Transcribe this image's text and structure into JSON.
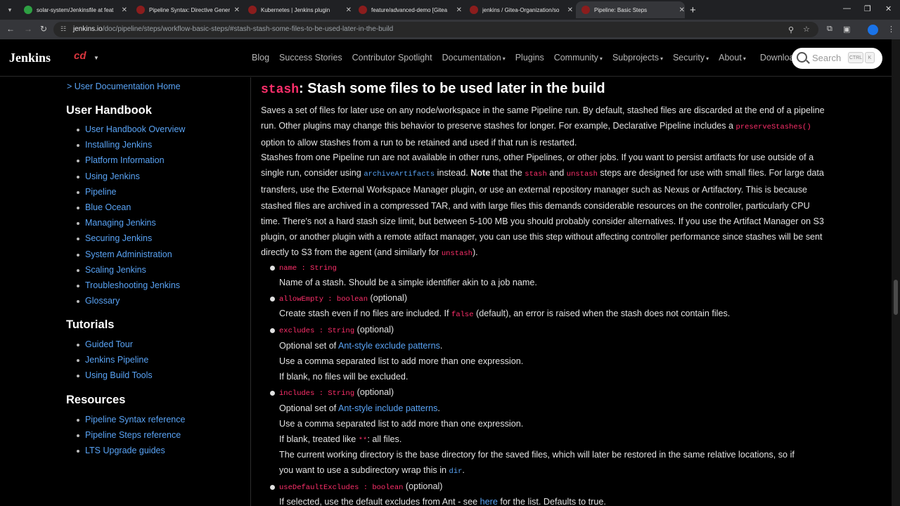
{
  "browser": {
    "tabs": [
      {
        "title": "solar-system/Jenkinsfile at feat",
        "color": "#2ea043"
      },
      {
        "title": "Pipeline Syntax: Directive Gener",
        "color": "#8b1d1d"
      },
      {
        "title": "Kubernetes | Jenkins plugin",
        "color": "#8b1d1d"
      },
      {
        "title": "feature/advanced-demo [Gitea",
        "color": "#8b1d1d"
      },
      {
        "title": "jenkins / Gitea-Organization/so",
        "color": "#8b1d1d"
      },
      {
        "title": "Pipeline: Basic Steps",
        "color": "#8b1d1d"
      }
    ],
    "url_domain": "jenkins.io",
    "url_path": "/doc/pipeline/steps/workflow-basic-steps/#stash-stash-some-files-to-be-used-later-in-the-build"
  },
  "navbar": {
    "brand": "Jenkins",
    "cd_logo": "cd",
    "links": [
      {
        "label": "Blog",
        "caret": ""
      },
      {
        "label": "Success Stories",
        "caret": ""
      },
      {
        "label": "Contributor Spotlight",
        "caret": ""
      },
      {
        "label": "Documentation",
        "caret": "▾"
      },
      {
        "label": "Plugins",
        "caret": ""
      },
      {
        "label": "Community",
        "caret": "▾"
      },
      {
        "label": "Subprojects",
        "caret": "▾"
      },
      {
        "label": "Security",
        "caret": "▾"
      },
      {
        "label": "About",
        "caret": "▾"
      },
      {
        "label": "Download",
        "caret": ""
      }
    ],
    "search_placeholder": "Search",
    "kbd_ctrl": "CTRL",
    "kbd_k": "K"
  },
  "sidebar": {
    "home_link": "> User Documentation Home",
    "sections": [
      {
        "title": "User Handbook",
        "items": [
          "User Handbook Overview",
          "Installing Jenkins",
          "Platform Information",
          "Using Jenkins",
          "Pipeline",
          "Blue Ocean",
          "Managing Jenkins",
          "Securing Jenkins",
          "System Administration",
          "Scaling Jenkins",
          "Troubleshooting Jenkins",
          "Glossary"
        ]
      },
      {
        "title": "Tutorials",
        "items": [
          "Guided Tour",
          "Jenkins Pipeline",
          "Using Build Tools"
        ]
      },
      {
        "title": "Resources",
        "items": [
          "Pipeline Syntax reference",
          "Pipeline Steps reference",
          "LTS Upgrade guides"
        ]
      }
    ]
  },
  "main": {
    "heading_code": "stash",
    "heading_text": ": Stash some files to be used later in the build",
    "p1": {
      "t1": "Saves a set of files for later use on any node/workspace in the same Pipeline run. By default, stashed files are discarded at the end of a pipeline run. Other plugins may change this behavior to preserve stashes for longer. For example, Declarative Pipeline includes a ",
      "c1": "preserveStashes()",
      "t2": " option to allow stashes from a run to be retained and used if that run is restarted."
    },
    "p2": {
      "t1": "Stashes from one Pipeline run are not available in other runs, other Pipelines, or other jobs. If you want to persist artifacts for use outside of a single run, consider using ",
      "c1": "archiveArtifacts",
      "t2": " instead. ",
      "b1": "Note",
      "t3": " that the ",
      "c2": "stash",
      "t4": " and ",
      "c3": "unstash",
      "t5": " steps are designed for use with small files. For large data transfers, use the External Workspace Manager plugin, or use an external repository manager such as Nexus or Artifactory. This is because stashed files are archived in a compressed TAR, and with large files this demands considerable resources on the controller, particularly CPU time. There's not a hard stash size limit, but between 5-100 MB you should probably consider alternatives. If you use the Artifact Manager on S3 plugin, or another plugin with a remote atifact manager, you can use this step without affecting controller performance since stashes will be sent directly to S3 from the agent (and similarly for ",
      "c4": "unstash",
      "t6": ")."
    },
    "params": {
      "name_sig": "name : String",
      "name_desc": "Name of a stash. Should be a simple identifier akin to a job name.",
      "allow_sig": "allowEmpty : boolean",
      "optional": " (optional)",
      "allow_desc1": "Create stash even if no files are included. If ",
      "allow_false": "false",
      "allow_desc2": " (default), an error is raised when the stash does not contain files.",
      "excl_sig": "excludes : String",
      "excl_d1a": "Optional set of ",
      "excl_link": "Ant-style exclude patterns",
      "dot": ".",
      "comma_list": "Use a comma separated list to add more than one expression.",
      "excl_blank": "If blank, no files will be excluded.",
      "incl_sig": "includes : String",
      "incl_link": "Ant-style include patterns",
      "incl_blank1": "If blank, treated like ",
      "incl_star": "**",
      "incl_blank2": ": all files.",
      "incl_cwd1": "The current working directory is the base directory for the saved files, which will later be restored in the same relative locations, so if",
      "incl_cwd2": "you want to use a subdirectory wrap this in ",
      "incl_dir": "dir",
      "ude_sig": "useDefaultExcludes : boolean",
      "ude_desc1": "If selected, use the default excludes from Ant - see ",
      "ude_here": "here",
      "ude_desc2": " for the list. Defaults to true."
    }
  }
}
